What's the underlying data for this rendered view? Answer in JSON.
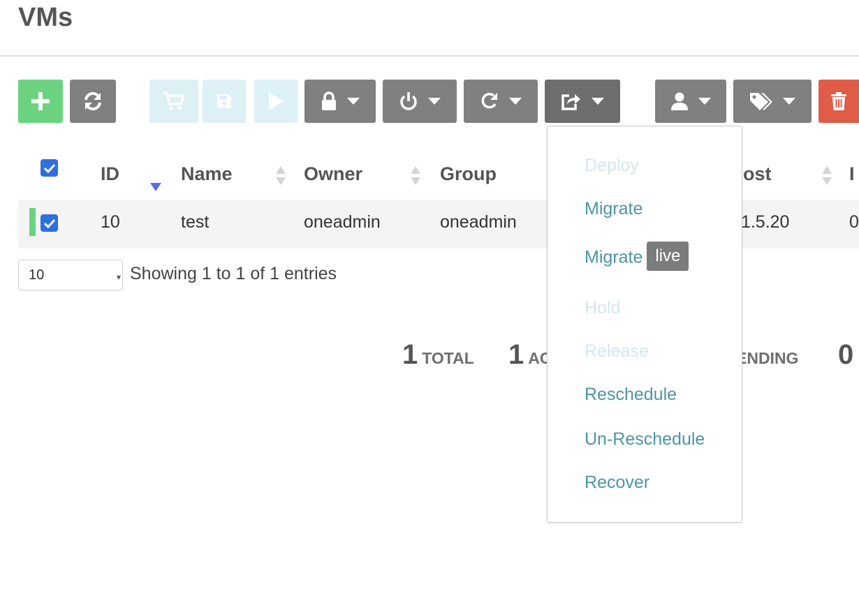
{
  "page": {
    "title": "VMs"
  },
  "toolbar": {
    "buttons": [
      {
        "name": "create",
        "icon": "plus-icon",
        "state": "enabled",
        "color": "#6bd37f"
      },
      {
        "name": "refresh",
        "icon": "refresh-icon",
        "state": "enabled",
        "color": "#808080"
      },
      {
        "name": "instantiate",
        "icon": "cart-icon",
        "state": "disabled"
      },
      {
        "name": "save",
        "icon": "save-icon",
        "state": "disabled"
      },
      {
        "name": "resume",
        "icon": "play-icon",
        "state": "disabled"
      },
      {
        "name": "lock",
        "icon": "lock-icon",
        "has_menu": true
      },
      {
        "name": "power",
        "icon": "power-icon",
        "has_menu": true
      },
      {
        "name": "reboot",
        "icon": "redo-icon",
        "has_menu": true
      },
      {
        "name": "actions",
        "icon": "share-icon",
        "has_menu": true,
        "open": true
      },
      {
        "name": "change-owner",
        "icon": "user-icon",
        "has_menu": true
      },
      {
        "name": "labels",
        "icon": "tags-icon",
        "has_menu": true
      },
      {
        "name": "delete",
        "icon": "trash-icon",
        "color": "#e05c46"
      }
    ]
  },
  "table": {
    "columns": [
      {
        "label": "ID",
        "sort": "desc"
      },
      {
        "label": "Name",
        "sort": "none"
      },
      {
        "label": "Owner",
        "sort": "none"
      },
      {
        "label": "Group",
        "sort": "none"
      },
      {
        "label": "ost",
        "sort": "none"
      },
      {
        "label": "I",
        "sort": "none"
      }
    ],
    "rows": [
      {
        "selected": true,
        "state_color": "#6bd37f",
        "cells": [
          "10",
          "test",
          "oneadmin",
          "oneadmin",
          ".1.5.20",
          "0"
        ]
      }
    ],
    "select_all": true
  },
  "pagination": {
    "page_length": "10",
    "info": "Showing 1 to 1 of 1 entries"
  },
  "stats": [
    {
      "value": "1",
      "label": "TOTAL"
    },
    {
      "value": "1",
      "label": "AC"
    },
    {
      "value": "",
      "label": "ENDING"
    },
    {
      "value": "0",
      "label": ""
    }
  ],
  "dropdown_menu": {
    "items": [
      {
        "label": "Deploy",
        "enabled": false
      },
      {
        "label": "Migrate",
        "enabled": true
      },
      {
        "label": "Migrate",
        "badge": "live",
        "enabled": true
      },
      {
        "label": "Hold",
        "enabled": false
      },
      {
        "label": "Release",
        "enabled": false
      },
      {
        "label": "Reschedule",
        "enabled": true
      },
      {
        "label": "Un-Reschedule",
        "enabled": true
      },
      {
        "label": "Recover",
        "enabled": true
      }
    ]
  },
  "colors": {
    "accent_link": "#4c94a8",
    "disabled_link": "#d3e7ee",
    "checkbox": "#2f6fde",
    "sort_active": "#5b6ee1"
  }
}
